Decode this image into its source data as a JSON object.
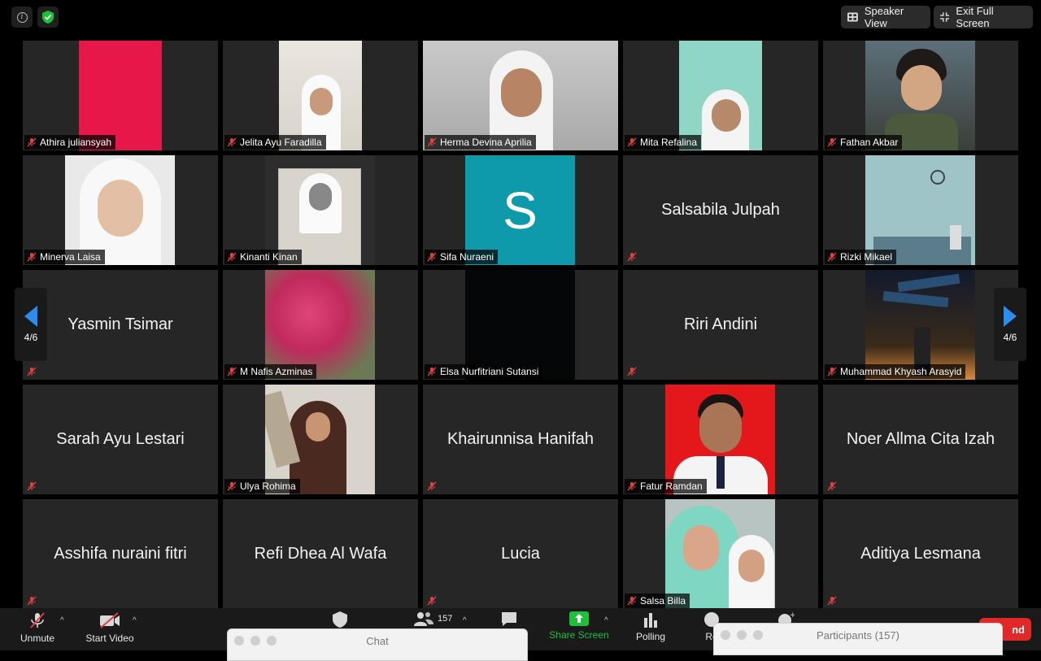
{
  "top": {
    "speaker_view": "Speaker View",
    "exit_full_screen": "Exit Full Screen"
  },
  "nav": {
    "page_left": "4/6",
    "page_right": "4/6"
  },
  "participants": [
    {
      "name": "Athira juliansyah"
    },
    {
      "name": "Jelita Ayu Faradilla"
    },
    {
      "name": "Herma Devina Aprilia"
    },
    {
      "name": "Mita Refalina"
    },
    {
      "name": "Fathan Akbar"
    },
    {
      "name": "Minerva Laisa"
    },
    {
      "name": "Kinanti Kinan"
    },
    {
      "name": "Sifa Nuraeni",
      "avatar_letter": "S"
    },
    {
      "name": "Salsabila Julpah"
    },
    {
      "name": "Rizki Mikael"
    },
    {
      "name": "Yasmin Tsimar"
    },
    {
      "name": "M Nafis Azminas"
    },
    {
      "name": "Elsa Nurfitriani Sutansi"
    },
    {
      "name": "Riri Andini"
    },
    {
      "name": "Muhammad Khyash Arasyid"
    },
    {
      "name": "Sarah Ayu Lestari"
    },
    {
      "name": "Ulya Rohima"
    },
    {
      "name": "Khairunnisa Hanifah"
    },
    {
      "name": "Fatur Ramdan"
    },
    {
      "name": "Noer Allma Cita Izah"
    },
    {
      "name": "Asshifa nuraini fitri"
    },
    {
      "name": "Refi Dhea Al Wafa"
    },
    {
      "name": "Lucia"
    },
    {
      "name": "Salsa Billa"
    },
    {
      "name": "Aditiya Lesmana"
    }
  ],
  "toolbar": {
    "unmute": "Unmute",
    "start_video": "Start Video",
    "participants_count": "157",
    "share_screen": "Share Screen",
    "polling": "Polling",
    "record_partial": "Re",
    "end_partial": "nd"
  },
  "windows": {
    "chat_title": "Chat",
    "participants_title": "Participants (157)"
  },
  "colors": {
    "accent_green": "#1fbf3b",
    "nav_blue": "#2d8cf0",
    "end_red": "#e02828",
    "muted_red": "#e04040"
  }
}
